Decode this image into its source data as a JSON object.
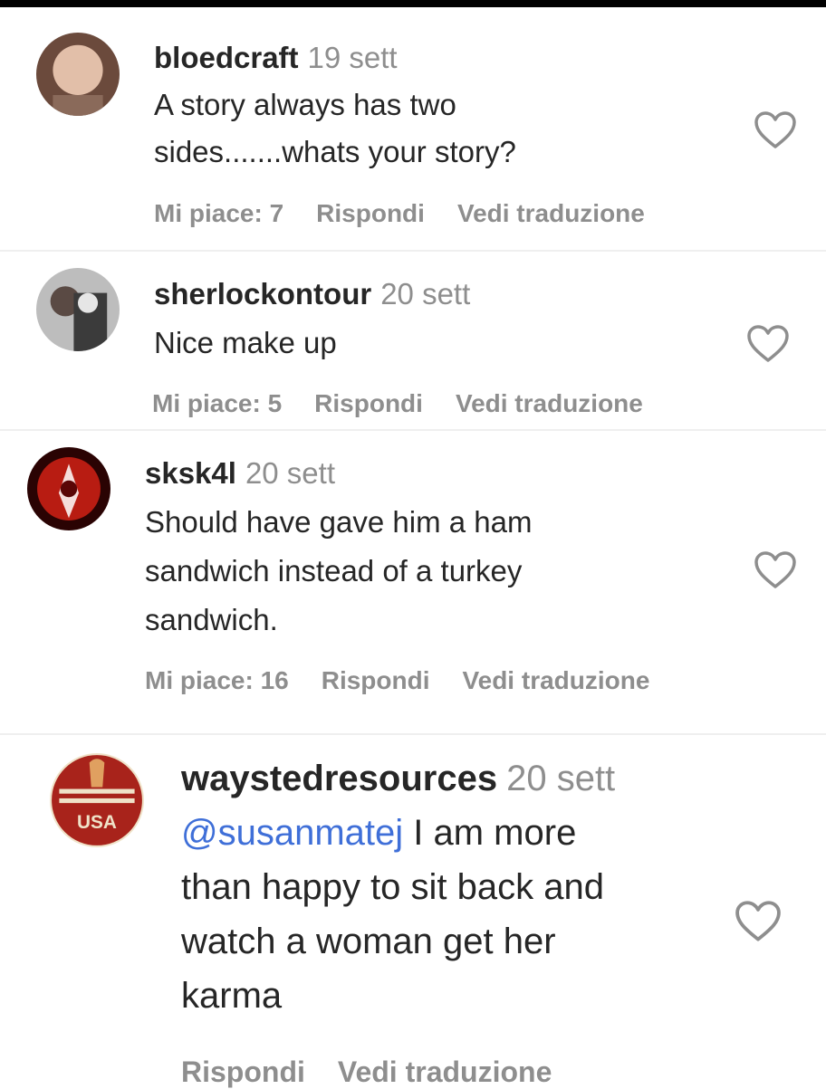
{
  "comments": [
    {
      "username": "bloedcraft",
      "time": "19 sett",
      "text": "A story always has two\nsides.......whats your story?",
      "likes": "Mi piace: 7",
      "reply": "Rispondi",
      "translate": "Vedi traduzione",
      "avatar_colors": [
        "#c9a28c",
        "#7a5a4a"
      ]
    },
    {
      "username": "sherlockontour",
      "time": "20 sett",
      "text": "Nice make up",
      "likes": "Mi piace: 5",
      "reply": "Rispondi",
      "translate": "Vedi traduzione",
      "avatar_colors": [
        "#9a9a9a",
        "#3a3a3a"
      ]
    },
    {
      "username": "sksk4l",
      "time": "20 sett",
      "text": "Should have gave him a ham\nsandwich instead of a turkey\nsandwich.",
      "likes": "Mi piace: 16",
      "reply": "Rispondi",
      "translate": "Vedi traduzione",
      "avatar_colors": [
        "#b21a14",
        "#3a0505"
      ]
    },
    {
      "username": "waystedresources",
      "time": "20 sett",
      "mention": "@susanmatej",
      "text": " I am more\nthan happy to sit back and\nwatch a woman get her\nkarma",
      "reply": "Rispondi",
      "translate": "Vedi traduzione",
      "avatar_colors": [
        "#a8231b",
        "#e0a060"
      ],
      "avatar_label": "USA"
    }
  ],
  "icons": {
    "like": "heart-outline-icon"
  },
  "colors": {
    "username": "#262626",
    "meta": "#8e8e8e",
    "mention": "#3f6fd8"
  }
}
